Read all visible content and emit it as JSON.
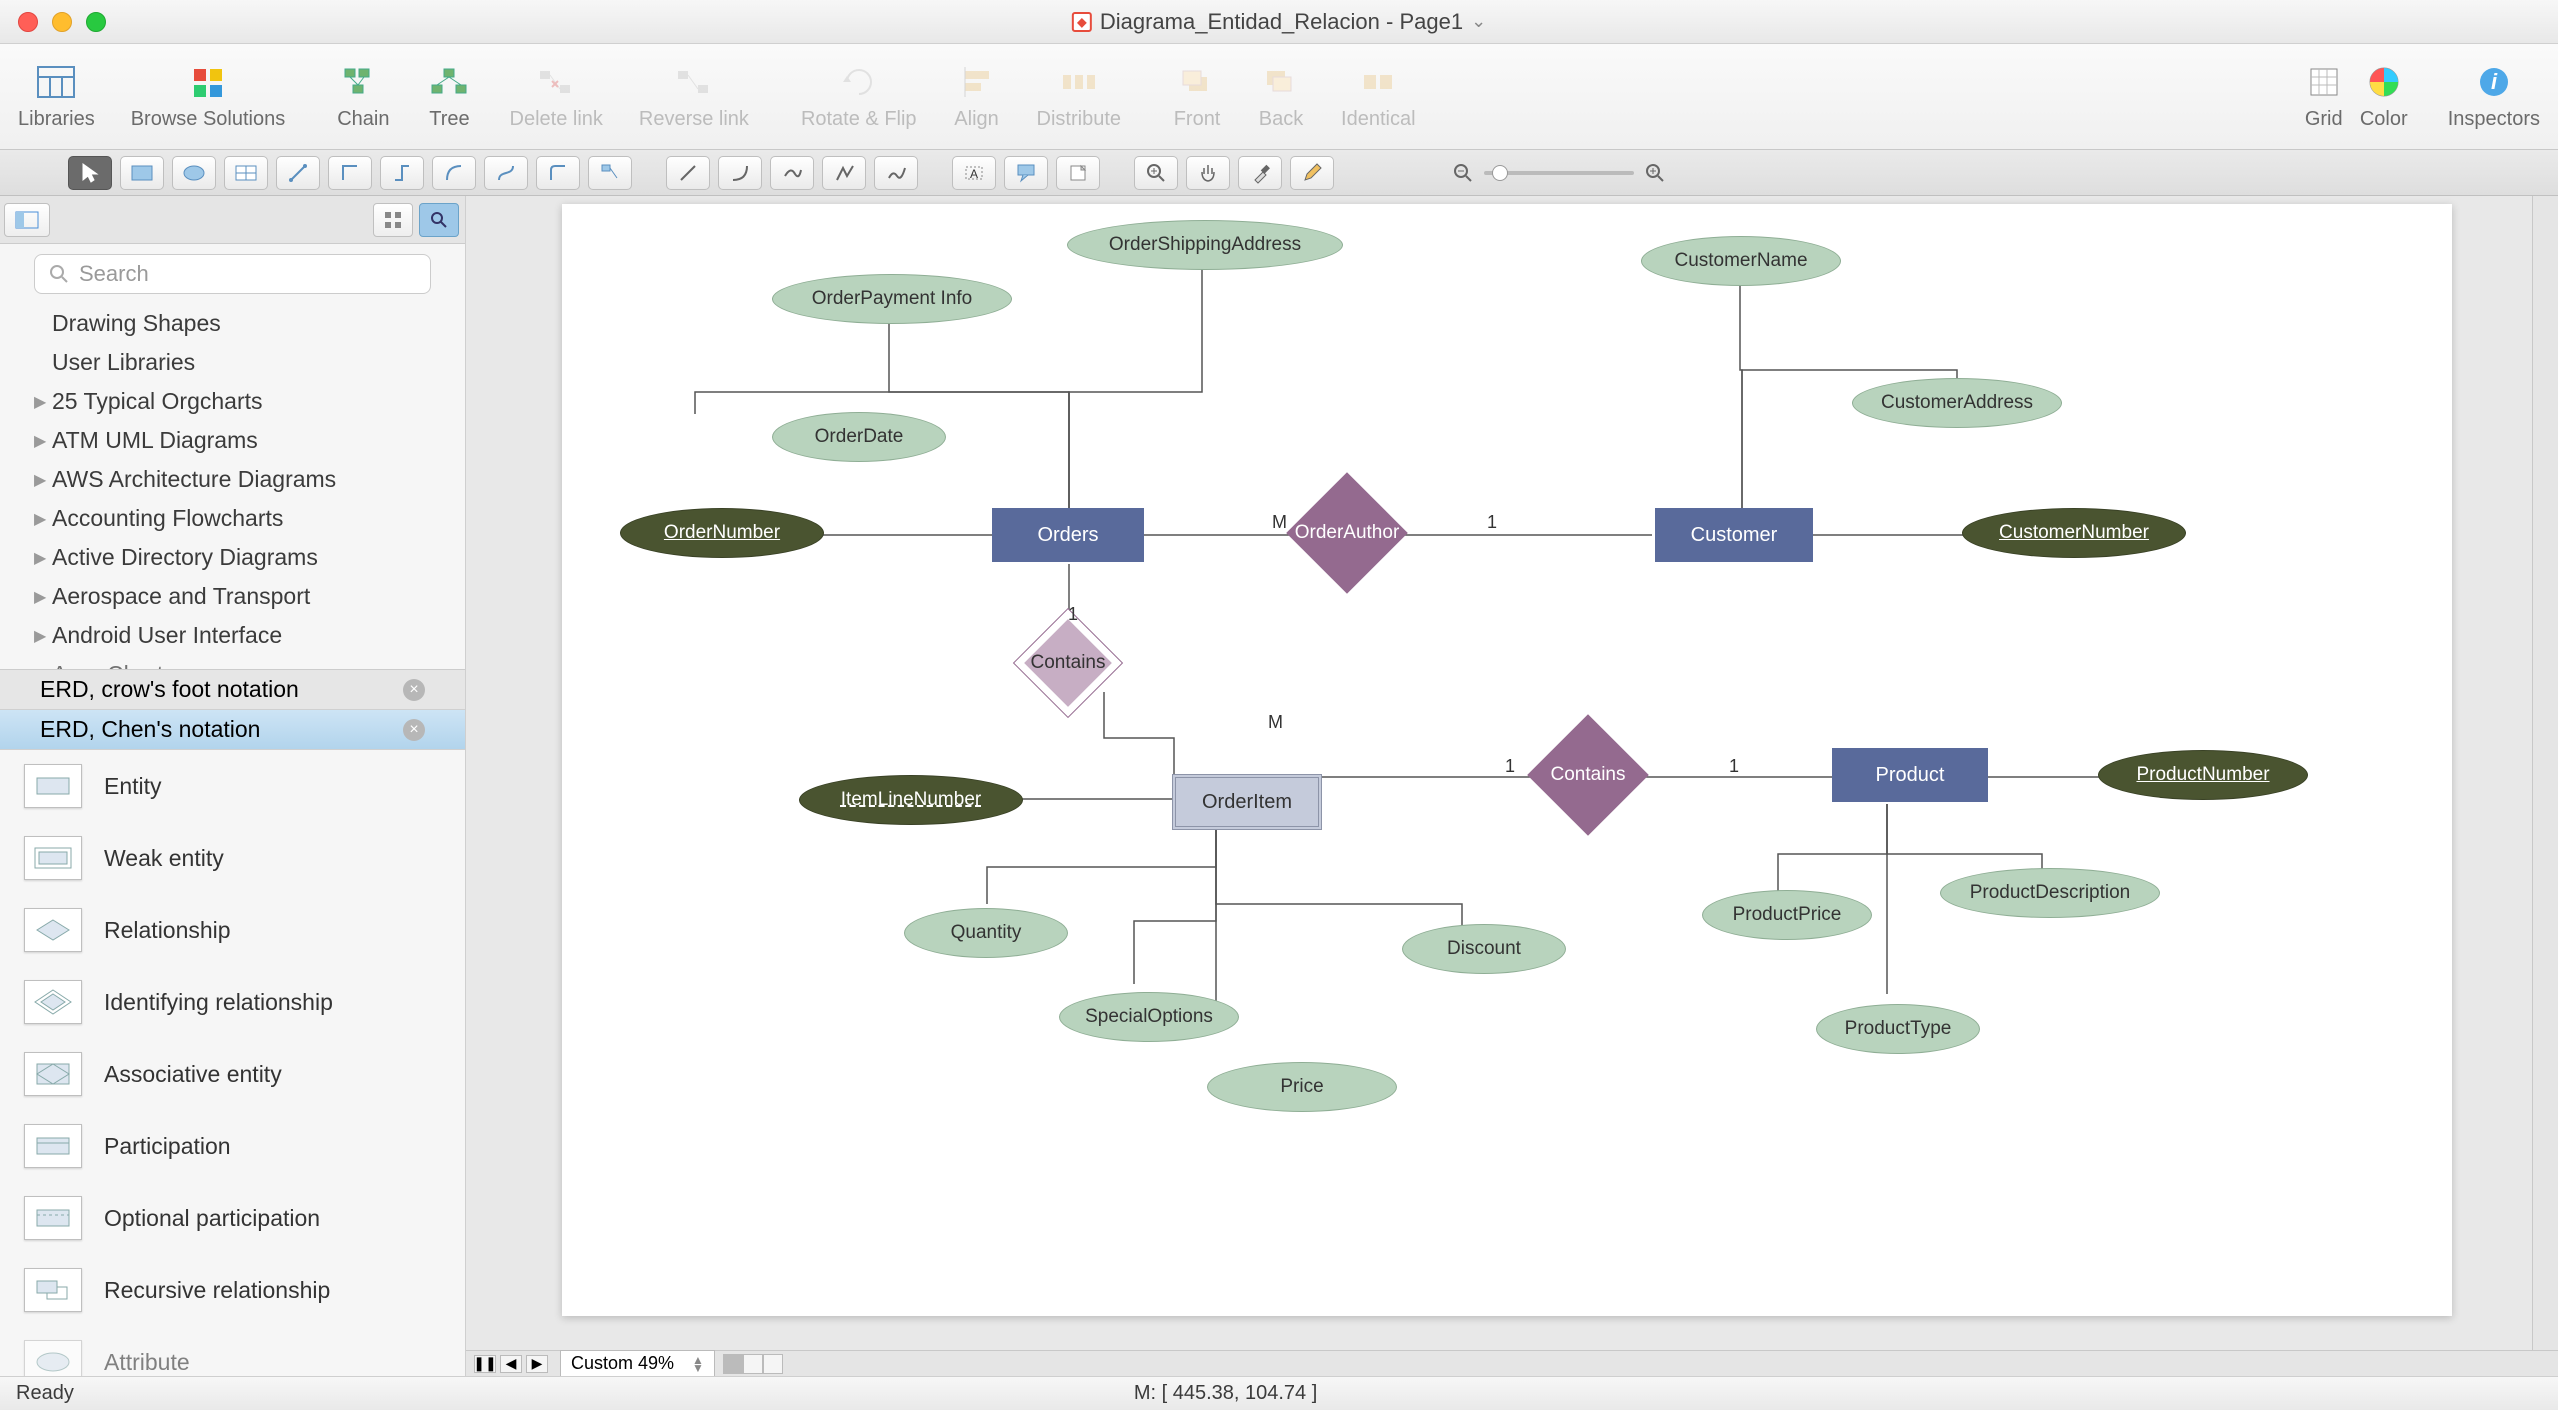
{
  "window": {
    "title": "Diagrama_Entidad_Relacion - Page1"
  },
  "toolbar": {
    "libraries": "Libraries",
    "browse": "Browse Solutions",
    "chain": "Chain",
    "tree": "Tree",
    "delete_link": "Delete link",
    "reverse_link": "Reverse link",
    "rotate_flip": "Rotate & Flip",
    "align": "Align",
    "distribute": "Distribute",
    "front": "Front",
    "back": "Back",
    "identical": "Identical",
    "grid": "Grid",
    "color": "Color",
    "inspectors": "Inspectors"
  },
  "sidebar": {
    "search_placeholder": "Search",
    "libs": [
      "Drawing Shapes",
      "User Libraries",
      "25 Typical Orgcharts",
      "ATM UML Diagrams",
      "AWS Architecture Diagrams",
      "Accounting Flowcharts",
      "Active Directory Diagrams",
      "Aerospace and Transport",
      "Android User Interface",
      "Area Charts"
    ],
    "tabs": {
      "crow": "ERD, crow's foot notation",
      "chen": "ERD, Chen's notation"
    },
    "shapes": [
      "Entity",
      "Weak entity",
      "Relationship",
      "Identifying relationship",
      "Associative entity",
      "Participation",
      "Optional participation",
      "Recursive relationship",
      "Attribute"
    ]
  },
  "diagram": {
    "entities": {
      "orders": "Orders",
      "customer": "Customer",
      "product": "Product",
      "orderitem": "OrderItem"
    },
    "relations": {
      "orderauthor": "OrderAuthor",
      "contains1": "Contains",
      "contains2": "Contains"
    },
    "attrs": {
      "orderpayment": "OrderPayment Info",
      "ordershipping": "OrderShippingAddress",
      "orderdate": "OrderDate",
      "ordernumber": "OrderNumber",
      "customername": "CustomerName",
      "customeraddress": "CustomerAddress",
      "customernumber": "CustomerNumber",
      "itemlinenumber": "ItemLineNumber",
      "quantity": "Quantity",
      "specialoptions": "SpecialOptions",
      "price": "Price",
      "discount": "Discount",
      "productprice": "ProductPrice",
      "productdesc": "ProductDescription",
      "producttype": "ProductType",
      "productnumber": "ProductNumber"
    },
    "cards": {
      "m": "M",
      "one": "1"
    }
  },
  "bottom": {
    "zoom": "Custom 49%"
  },
  "status": {
    "ready": "Ready",
    "mouse": "M: [ 445.38, 104.74 ]"
  }
}
